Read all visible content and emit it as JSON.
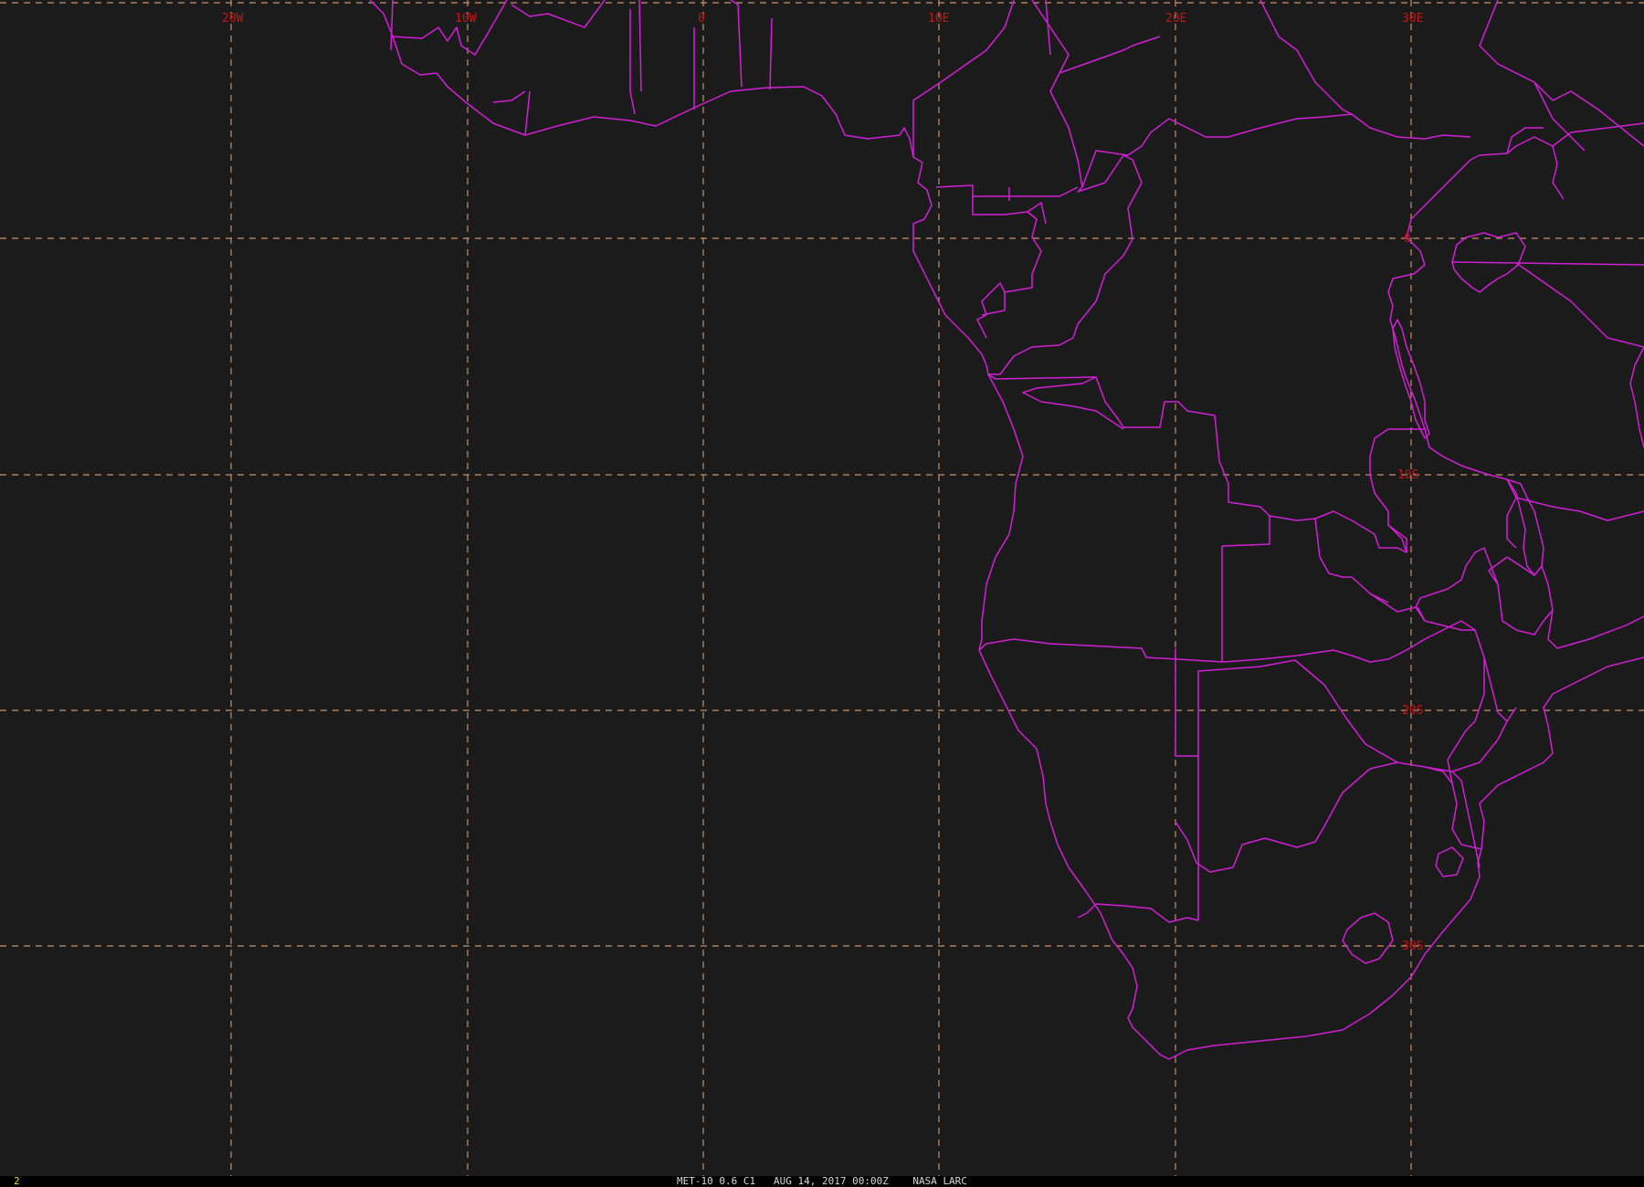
{
  "product": {
    "satellite": "MET-10",
    "channel": "0.6 C1",
    "datetime": "AUG 14, 2017 00:00Z",
    "agency": "NASA LARC",
    "caption": "MET-10 0.6 C1   AUG 14, 2017 00:00Z    NASA LARC"
  },
  "frame_number": "2",
  "grid": {
    "longitude_labels": [
      "20W",
      "10W",
      "0",
      "10E",
      "20E",
      "30E"
    ],
    "latitude_labels": [
      "0",
      "10S",
      "20S",
      "30S"
    ]
  },
  "colors": {
    "background": "#1b1b1b",
    "gridline": "#c8906a",
    "grid_label": "#c01818",
    "boundaries": "#d21fd6",
    "frame_number": "#e8e000"
  }
}
